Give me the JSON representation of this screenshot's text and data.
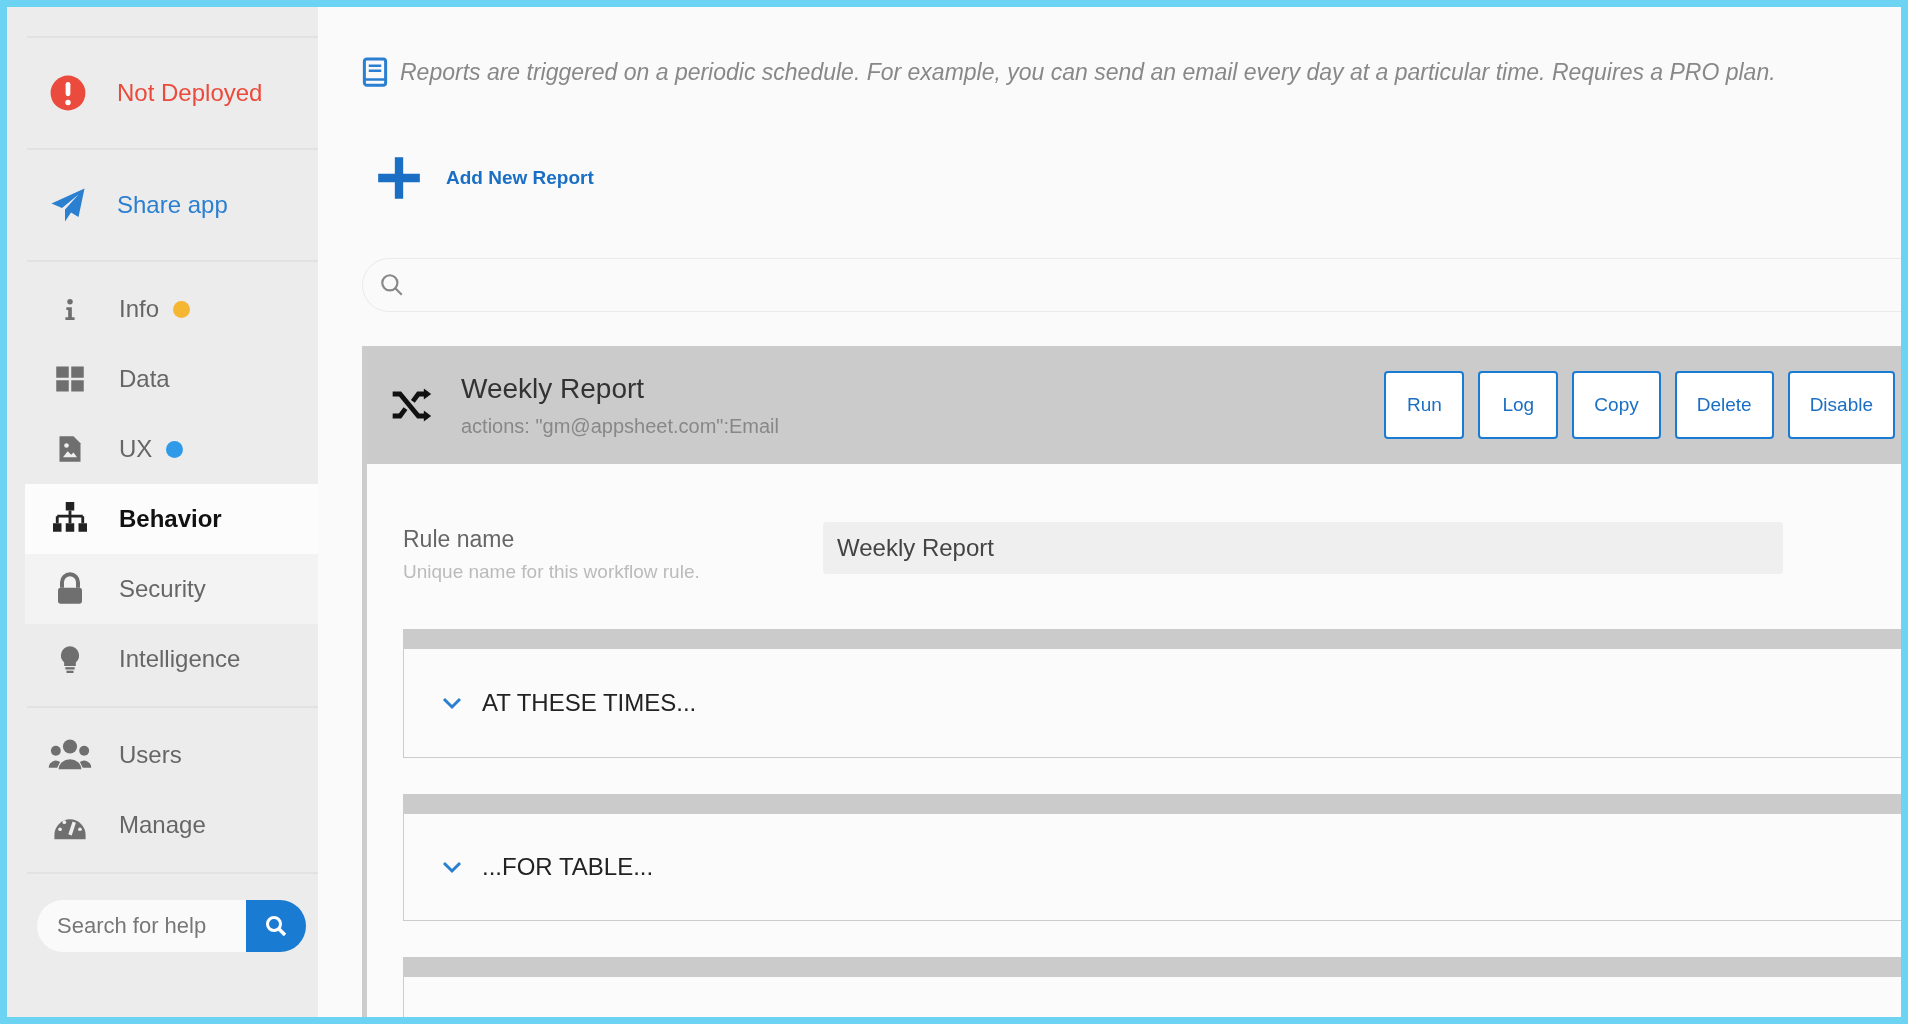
{
  "sidebar": {
    "status": {
      "label": "Not Deployed"
    },
    "share": {
      "label": "Share app"
    },
    "groups": [
      [
        {
          "kind": "info",
          "label": "Info",
          "selected": false,
          "color": "#f5b731"
        },
        {
          "kind": "data",
          "label": "Data",
          "selected": false
        },
        {
          "kind": "ux",
          "label": "UX",
          "selected": false,
          "color": "#2f9be8"
        },
        {
          "kind": "behavior",
          "label": "Behavior",
          "selected": true
        },
        {
          "kind": "security",
          "label": "Security",
          "selected": false
        },
        {
          "kind": "intelligence",
          "label": "Intelligence",
          "selected": false
        }
      ],
      [
        {
          "kind": "users",
          "label": "Users",
          "selected": false
        },
        {
          "kind": "manage",
          "label": "Manage",
          "selected": false
        }
      ]
    ],
    "help_search": {
      "placeholder": "Search for help"
    }
  },
  "main": {
    "note": "Reports are triggered on a periodic schedule. For example, you can send an email every day at a particular time. Requires a PRO plan.",
    "add_button": "Add New Report",
    "report": {
      "title": "Weekly Report",
      "subtitle": "actions: \"gm@appsheet.com\":Email",
      "buttons": [
        "Run",
        "Log",
        "Copy",
        "Delete",
        "Disable"
      ],
      "rule_name": {
        "label": "Rule name",
        "hint": "Unique name for this workflow rule.",
        "value": "Weekly Report"
      },
      "sections": [
        {
          "title": "AT THESE TIMES...",
          "expanded": false
        },
        {
          "title": "...FOR TABLE...",
          "expanded": false
        }
      ]
    }
  }
}
